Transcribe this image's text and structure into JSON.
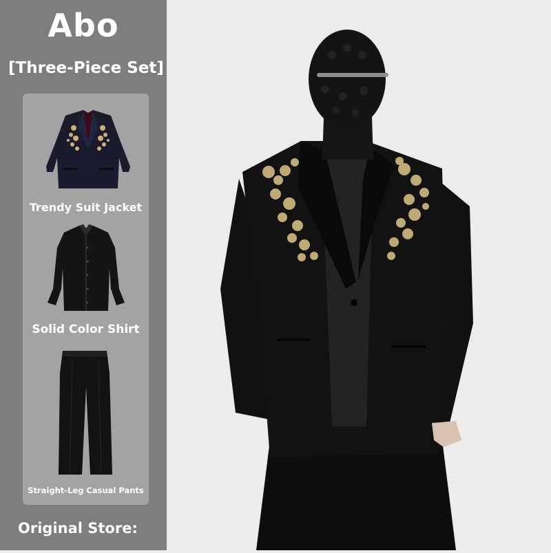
{
  "brand": "Abo",
  "subtitle": "[Three-Piece Set]",
  "items": [
    {
      "label": "Trendy Suit Jacket",
      "icon": "suit-jacket"
    },
    {
      "label": "Solid Color Shirt",
      "icon": "shirt"
    },
    {
      "label": "Straight-Leg Casual Pants",
      "icon": "pants"
    }
  ],
  "footer": "Original Store:",
  "colors": {
    "sidebar": "#7d7d7d",
    "card": "#a3a3a3",
    "embroidery": "#c9b27a"
  }
}
